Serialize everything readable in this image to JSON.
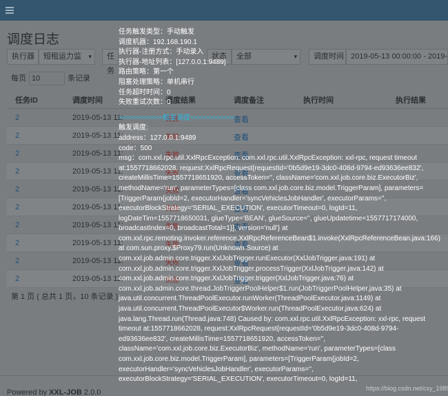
{
  "header": {
    "menu_icon": "hamburger-icon"
  },
  "page": {
    "title": "调度日志"
  },
  "filters": {
    "executor_label": "执行器",
    "executor_value": "短租运力监",
    "task_label": "任务",
    "status_label": "状态",
    "status_value": "全部",
    "time_label": "调度时间",
    "time_value": "2019-05-13 00:00:00 - 2019-0"
  },
  "pagination": {
    "prefix": "每页",
    "page_size": "10",
    "suffix": "条记录",
    "info": "第 1 页 ( 总共 1 页，10 条记录 )"
  },
  "table": {
    "columns": [
      "任务ID",
      "调度时间",
      "调度结果",
      "调度备注",
      "执行时间",
      "执行结果"
    ],
    "rows": [
      {
        "id": "2",
        "time": "2019-05-13 11:",
        "result": "失败",
        "note": "查看"
      },
      {
        "id": "2",
        "time": "2019-05-13 11:",
        "result": "失败",
        "note": "查看"
      },
      {
        "id": "2",
        "time": "2019-05-13 11:",
        "result": "失败",
        "note": "查看"
      },
      {
        "id": "2",
        "time": "2019-05-13 11:",
        "result": "失败",
        "note": "查看"
      },
      {
        "id": "2",
        "time": "2019-05-13 11:",
        "result": "失败",
        "note": "查看"
      },
      {
        "id": "2",
        "time": "2019-05-13 11:",
        "result": "失败",
        "note": "查看"
      },
      {
        "id": "2",
        "time": "2019-05-13 11:",
        "result": "失败",
        "note": "查看"
      },
      {
        "id": "2",
        "time": "2019-05-13 11:",
        "result": "失败",
        "note": "查看"
      },
      {
        "id": "2",
        "time": "2019-05-13 11:",
        "result": "失败",
        "note": "查看"
      },
      {
        "id": "2",
        "time": "2019-05-13 11:",
        "result": "失败",
        "note": "查看"
      }
    ]
  },
  "popover": {
    "l1": "任务触发类型：手动触发",
    "l2": "调度机器：192.168.190.1",
    "l3": "执行器-注册方式：手动录入",
    "l4": "执行器-地址列表：[127.0.0.1:9489]",
    "l5": "路由策略：第一个",
    "l6": "阻塞处理策略：单机串行",
    "l7": "任务超时时间：0",
    "l8": "失败重试次数：0",
    "l9": ">>>>>>>>>>>触发调度<<<<<<<<<<<",
    "l10": "触发调度:",
    "l11": "address：127.0.0.1:9489",
    "l12": "code：500",
    "msg": "msg：com.xxl.rpc.util.XxlRpcException: com.xxl.rpc.util.XxlRpcException: xxl-rpc, request timeout at:1557718662028, request:XxlRpcRequest{requestId='0b5d9e19-3dc0-408d-9794-ed93636ee832', createMillisTime=1557718651920, accessToken='', className='com.xxl.job.core.biz.ExecutorBiz', methodName='run', parameterTypes=[class com.xxl.job.core.biz.model.TriggerParam], parameters=[TriggerParam{jobId=2, executorHandler='syncVehiclesJobHandler', executorParams='', executorBlockStrategy='SERIAL_EXECUTION', executorTimeout=0, logId=11, logDateTim=1557718650031, glueType='BEAN', glueSource='', glueUpdatetime=1557717174000, broadcastIndex=0, broadcastTotal=1}], version='null'} at com.xxl.rpc.remoting.invoker.reference.XxlRpcReferenceBean$1.invoke(XxlRpcReferenceBean.java:166) at com.sun.proxy.$Proxy79.run(Unknown Source) at com.xxl.job.admin.core.trigger.XxlJobTrigger.runExecutor(XxlJobTrigger.java:191) at com.xxl.job.admin.core.trigger.XxlJobTrigger.processTrigger(XxlJobTrigger.java:142) at com.xxl.job.admin.core.trigger.XxlJobTrigger.trigger(XxlJobTrigger.java:76) at com.xxl.job.admin.core.thread.JobTriggerPoolHelper$1.run(JobTriggerPoolHelper.java:35) at java.util.concurrent.ThreadPoolExecutor.runWorker(ThreadPoolExecutor.java:1149) at java.util.concurrent.ThreadPoolExecutor$Worker.run(ThreadPoolExecutor.java:624) at java.lang.Thread.run(Thread.java:748) Caused by: com.xxl.rpc.util.XxlRpcException: xxl-rpc, request timeout at:1557718662028, request:XxlRpcRequest{requestId='0b5d9e19-3dc0-408d-9794-ed93636ee832', createMillisTime=1557718651920, accessToken='', className='com.xxl.job.core.biz.ExecutorBiz', methodName='run', parameterTypes=[class com.xxl.job.core.biz.model.TriggerParam], parameters=[TriggerParam{jobId=2, executorHandler='syncVehiclesJobHandler', executorParams='', executorBlockStrategy='SERIAL_EXECUTION', executorTimeout=0, logId=11,"
  },
  "footer": {
    "prefix": "Powered by ",
    "brand": "XXL-JOB",
    "version": " 2.0.0"
  },
  "watermark": "https://blog.csdn.net/cxy_19891109"
}
